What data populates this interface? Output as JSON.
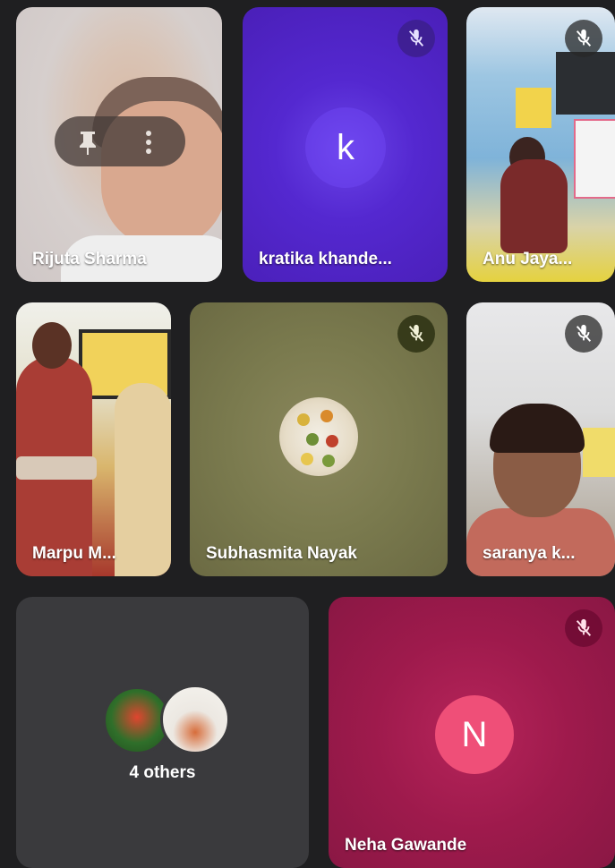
{
  "participants": [
    {
      "name": "Rijuta Sharma",
      "muted": false,
      "pinned_controls": true
    },
    {
      "name": "kratika khande...",
      "initial": "k",
      "muted": true,
      "avatar_color": "#5a2fd6"
    },
    {
      "name": "Anu Jaya...",
      "muted": true
    },
    {
      "name": "Marpu M...",
      "muted": false
    },
    {
      "name": "Subhasmita Nayak",
      "muted": true
    },
    {
      "name": "saranya k...",
      "muted": true
    },
    {
      "name": "Neha Gawande",
      "initial": "N",
      "muted": true,
      "avatar_color": "#f0527a"
    }
  ],
  "others": {
    "label": "4 others"
  },
  "colors": {
    "background": "#1f1f21",
    "kratika_tile": "#5428d0",
    "neha_tile": "#9e1a4c",
    "neha_avatar": "#ef4f78",
    "others_tile": "#3a3a3d"
  },
  "icons": [
    "pin-icon",
    "more-vert-icon",
    "mic-off-icon"
  ]
}
